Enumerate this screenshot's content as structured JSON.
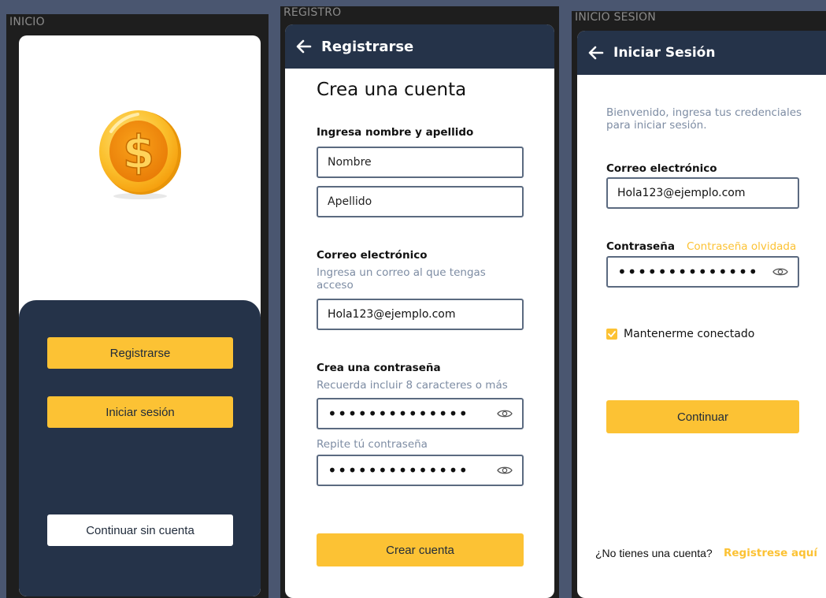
{
  "colors": {
    "background": "#4a5670",
    "navy": "#253349",
    "accent_yellow": "#fcc234",
    "input_border": "#5b6a80",
    "hint_text": "#7d8ca3"
  },
  "inicio": {
    "frame_label": "INICIO",
    "logo_icon": "dollar-coin-icon",
    "register_button": "Registrarse",
    "login_button": "Iniciar sesión",
    "guest_button": "Continuar sin cuenta"
  },
  "registro": {
    "frame_label": "REGISTRO",
    "header_title": "Registrarse",
    "heading": "Crea una cuenta",
    "name_label": "Ingresa nombre y apellido",
    "first_name_placeholder": "Nombre",
    "last_name_placeholder": "Apellido",
    "email_label": "Correo electrónico",
    "email_hint": "Ingresa un correo al que tengas acceso",
    "email_value": "Hola123@ejemplo.com",
    "password_label": "Crea una contraseña",
    "password_hint": "Recuerda incluir 8 caracteres o más",
    "password_value": "••••••••••••••",
    "repeat_password_hint": "Repite tú contraseña",
    "repeat_password_value": "••••••••••••••",
    "submit_button": "Crear cuenta"
  },
  "inicio_sesion": {
    "frame_label": "INICIO SESION",
    "header_title": "Iniciar Sesión",
    "welcome_text": "Bienvenido, ingresa tus credenciales para iniciar sesión.",
    "email_label": "Correo electrónico",
    "email_value": "Hola123@ejemplo.com",
    "password_label": "Contraseña",
    "forgot_link": "Contraseña olvidada",
    "password_value": "••••••••••••••",
    "remember_label": "Mantenerme conectado",
    "remember_checked": true,
    "continue_button": "Continuar",
    "no_account_text": "¿No tienes una cuenta?",
    "register_link": "Registrese aquí"
  }
}
